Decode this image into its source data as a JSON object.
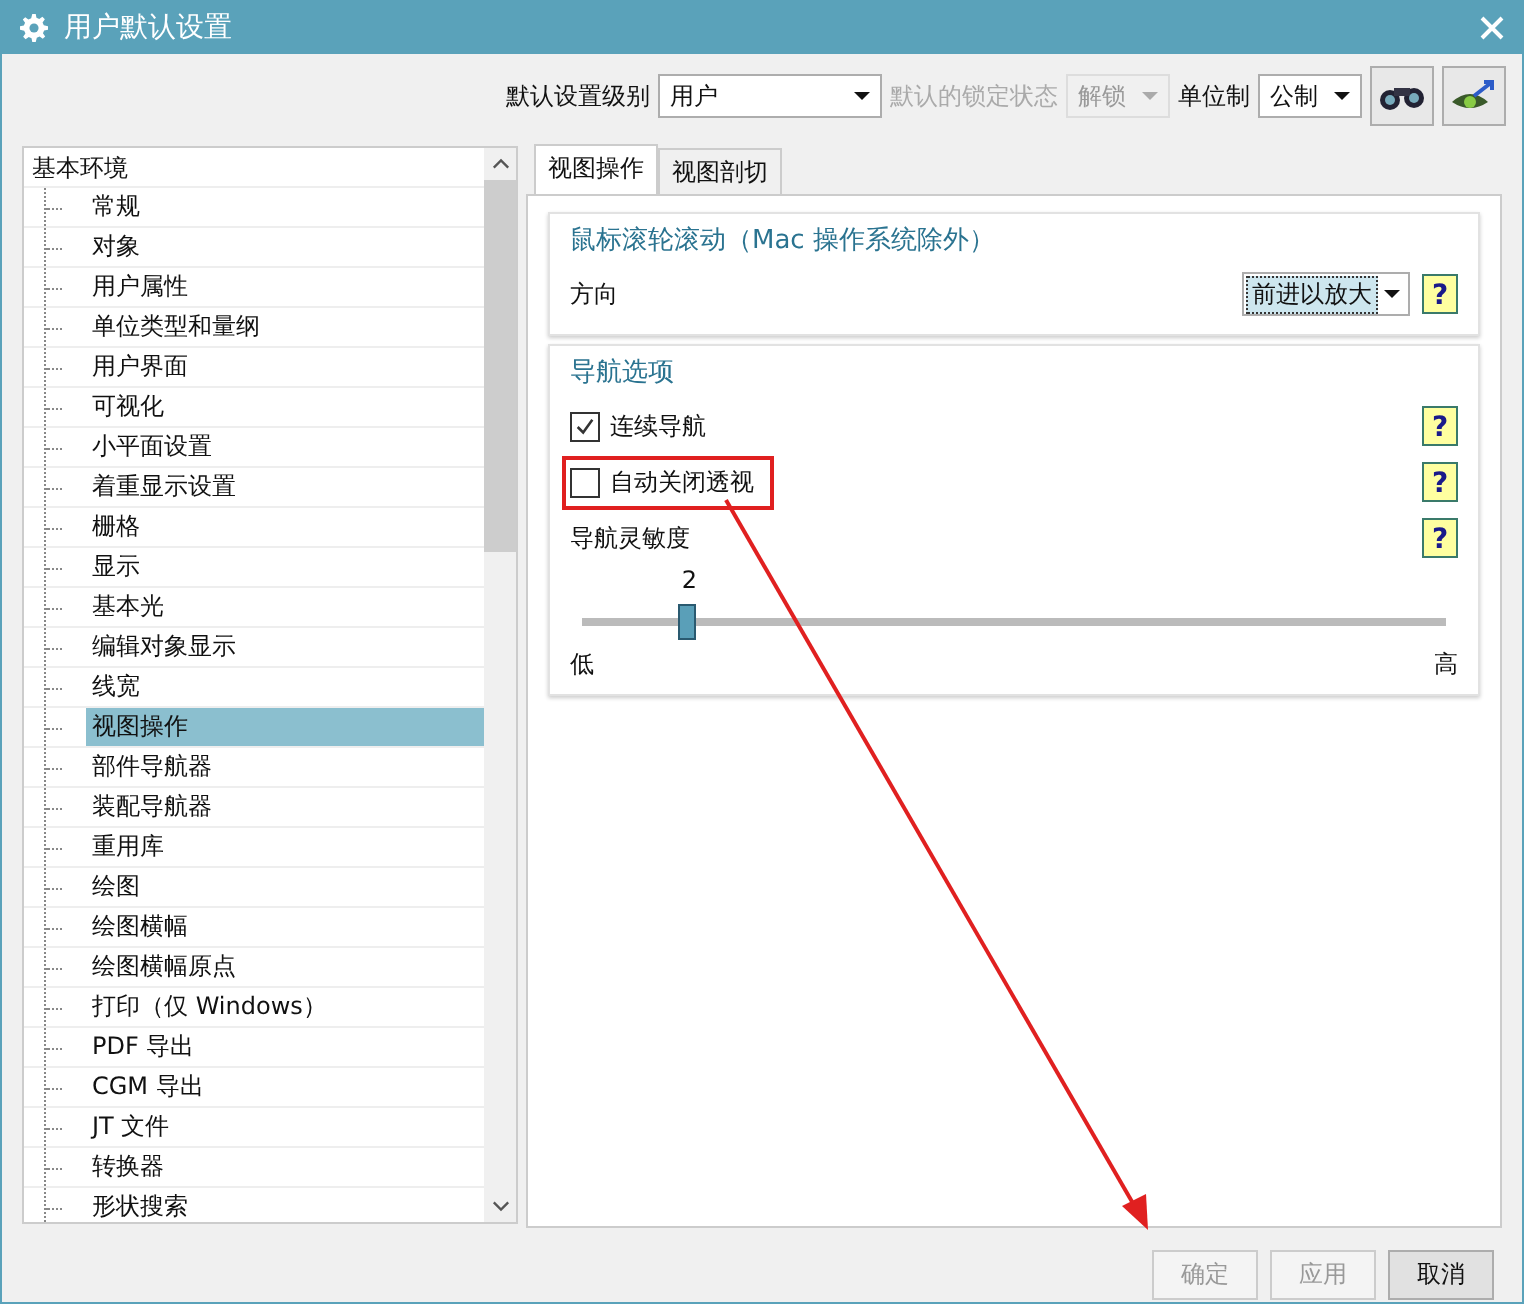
{
  "window": {
    "title": "用户默认设置"
  },
  "toolbar": {
    "fields": [
      {
        "label": "默认设置级别",
        "value": "用户",
        "disabled": false,
        "kind": "wide"
      },
      {
        "label": "默认的锁定状态",
        "value": "解锁",
        "disabled": true,
        "kind": "narrow"
      },
      {
        "label": "单位制",
        "value": "公制",
        "disabled": false,
        "kind": "narrow"
      }
    ]
  },
  "tree": {
    "label": "基本环境",
    "selected": false,
    "children": [
      {
        "label": "常规",
        "selected": false
      },
      {
        "label": "对象",
        "selected": false
      },
      {
        "label": "用户属性",
        "selected": false
      },
      {
        "label": "单位类型和量纲",
        "selected": false
      },
      {
        "label": "用户界面",
        "selected": false
      },
      {
        "label": "可视化",
        "selected": false
      },
      {
        "label": "小平面设置",
        "selected": false
      },
      {
        "label": "着重显示设置",
        "selected": false
      },
      {
        "label": "栅格",
        "selected": false
      },
      {
        "label": "显示",
        "selected": false
      },
      {
        "label": "基本光",
        "selected": false
      },
      {
        "label": "编辑对象显示",
        "selected": false
      },
      {
        "label": "线宽",
        "selected": false
      },
      {
        "label": "视图操作",
        "selected": true
      },
      {
        "label": "部件导航器",
        "selected": false
      },
      {
        "label": "装配导航器",
        "selected": false
      },
      {
        "label": "重用库",
        "selected": false
      },
      {
        "label": "绘图",
        "selected": false
      },
      {
        "label": "绘图横幅",
        "selected": false
      },
      {
        "label": "绘图横幅原点",
        "selected": false
      },
      {
        "label": "打印（仅 Windows）",
        "selected": false
      },
      {
        "label": "PDF 导出",
        "selected": false
      },
      {
        "label": "CGM 导出",
        "selected": false
      },
      {
        "label": "JT 文件",
        "selected": false
      },
      {
        "label": "转换器",
        "selected": false
      },
      {
        "label": "形状搜索",
        "selected": false
      }
    ]
  },
  "tabs": [
    {
      "label": "视图操作",
      "selected": true
    },
    {
      "label": "视图剖切",
      "selected": false
    }
  ],
  "sections": [
    {
      "title": "鼠标滚轮滚动（Mac 操作系统除外）",
      "rows": [
        {
          "kind": "dropdown",
          "label": "方向",
          "value": "前进以放大",
          "help": "?"
        }
      ]
    },
    {
      "title": "导航选项",
      "rows": [
        {
          "kind": "checkbox",
          "label": "连续导航",
          "checked": true,
          "help": "?"
        },
        {
          "kind": "checkbox",
          "label": "自动关闭透视",
          "checked": false,
          "help": "?",
          "highlighted": true
        },
        {
          "kind": "slider",
          "label": "导航灵敏度",
          "help": "?",
          "value": "2",
          "level": 0.12,
          "min_label": "低",
          "max_label": "高"
        }
      ]
    }
  ],
  "buttons": [
    {
      "label": "确定",
      "disabled": true
    },
    {
      "label": "应用",
      "disabled": true
    },
    {
      "label": "取消",
      "disabled": false
    }
  ]
}
